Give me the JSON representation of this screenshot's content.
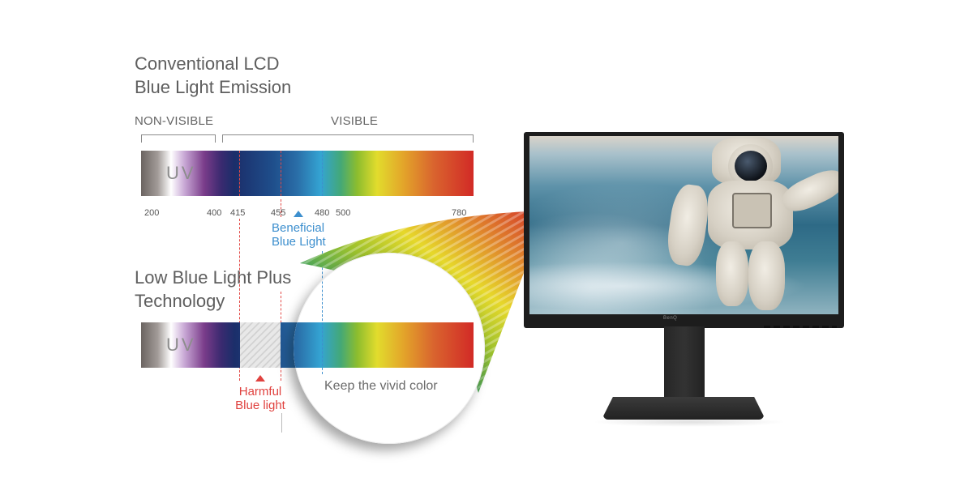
{
  "conventional": {
    "title_line1": "Conventional LCD",
    "title_line2": "Blue Light Emission",
    "non_visible_label": "NON-VISIBLE",
    "visible_label": "VISIBLE",
    "uv_label": "UV",
    "ticks": [
      "200",
      "400",
      "415",
      "455",
      "480",
      "500",
      "780"
    ],
    "beneficial_line1": "Beneficial",
    "beneficial_line2": "Blue Light"
  },
  "low_blue": {
    "title_line1": "Low Blue Light Plus",
    "title_line2": "Technology",
    "uv_label": "UV",
    "harmful_line1": "Harmful",
    "harmful_line2": "Blue light",
    "magnifier_caption": "Keep the vivid color"
  },
  "monitor": {
    "brand": "BenQ",
    "screen_subject": "astronaut-over-earth"
  },
  "colors": {
    "beneficial_blue": "#3d8fce",
    "harmful_red": "#e0423f",
    "text_gray": "#5e5e5e",
    "bezel": "#1d1d1d"
  }
}
